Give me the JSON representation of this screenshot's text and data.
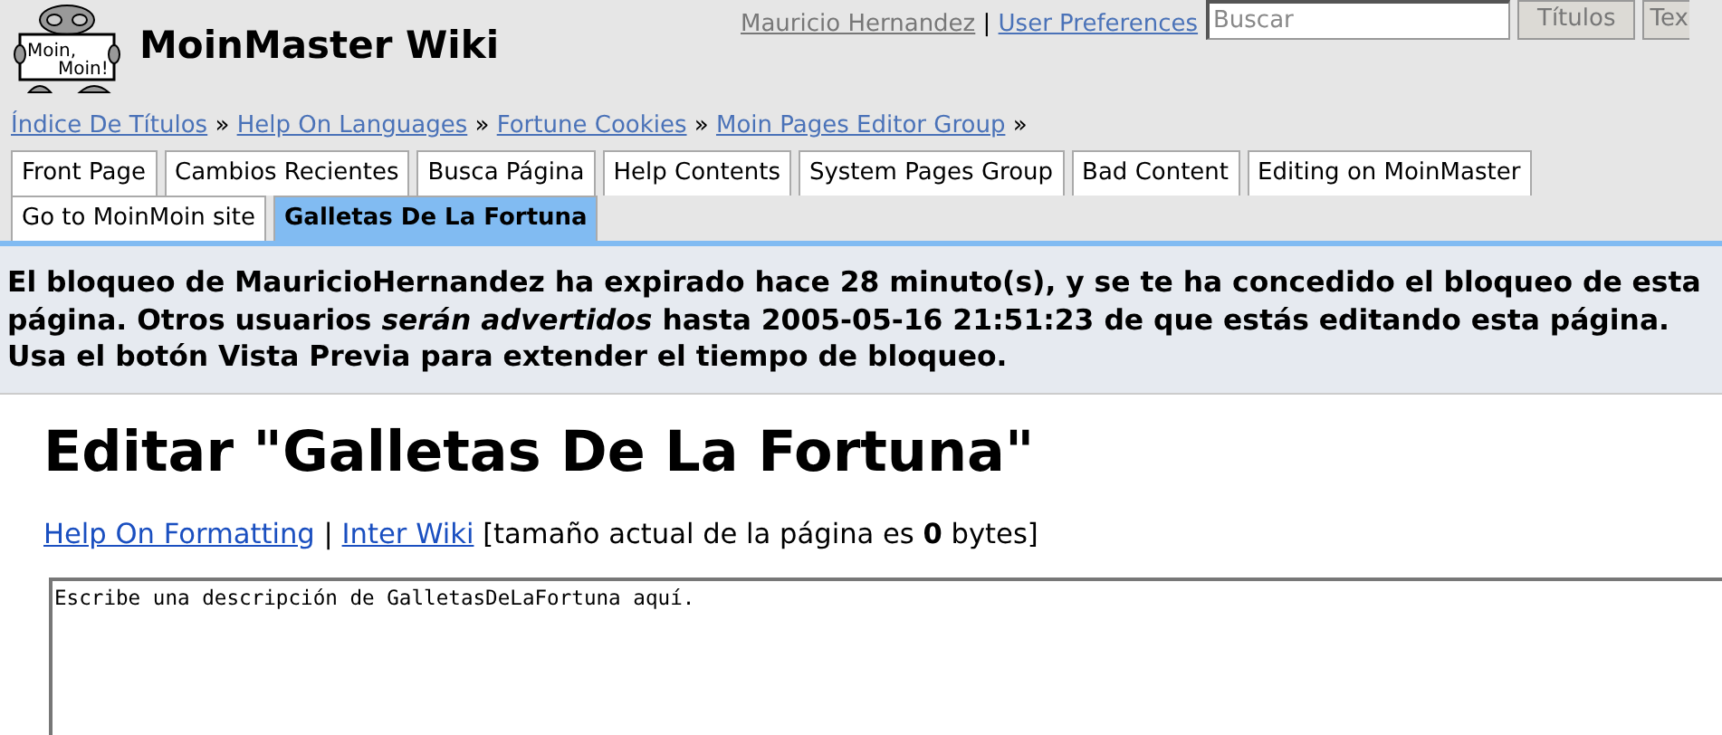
{
  "logo": {
    "lines": [
      "Moin,",
      "Moin!"
    ]
  },
  "site_title": "MoinMaster Wiki",
  "user_link_separator": "|",
  "user_links": [
    {
      "label": "Mauricio Hernandez",
      "kind": "user"
    },
    {
      "label": "User Preferences",
      "kind": "link"
    }
  ],
  "search": {
    "placeholder": "Buscar",
    "buttons": [
      "Títulos",
      "Tex"
    ]
  },
  "breadcrumbs": [
    "Índice De Títulos",
    "Help On Languages",
    "Fortune Cookies",
    "Moin Pages Editor Group"
  ],
  "breadcrumb_separator": "»",
  "tabs": [
    {
      "label": "Front Page",
      "selected": false
    },
    {
      "label": "Cambios Recientes",
      "selected": false
    },
    {
      "label": "Busca Página",
      "selected": false
    },
    {
      "label": "Help Contents",
      "selected": false
    },
    {
      "label": "System Pages Group",
      "selected": false
    },
    {
      "label": "Bad Content",
      "selected": false
    },
    {
      "label": "Editing on MoinMaster",
      "selected": false
    },
    {
      "label": "Go to MoinMoin site",
      "selected": false
    },
    {
      "label": "Galletas De La Fortuna",
      "selected": true
    }
  ],
  "message": "El bloqueo de MauricioHernandez ha expirado hace 28 minuto(s), y se te ha concedido el bloqueo de esta página. Otros usuarios *serán advertidos* hasta 2005-05-16 21:51:23 de que estás editando esta página. Usa el botón Vista Previa para extender el tiempo de bloqueo.",
  "heading": "Editar \"Galletas De La Fortuna\"",
  "help_links": [
    "Help On Formatting",
    "Inter Wiki"
  ],
  "help_separator": "|",
  "size_note": "[tamaño actual de la página es **0** bytes]",
  "editor": {
    "value": "Escribe una descripción de GalletasDeLaFortuna aquí."
  }
}
